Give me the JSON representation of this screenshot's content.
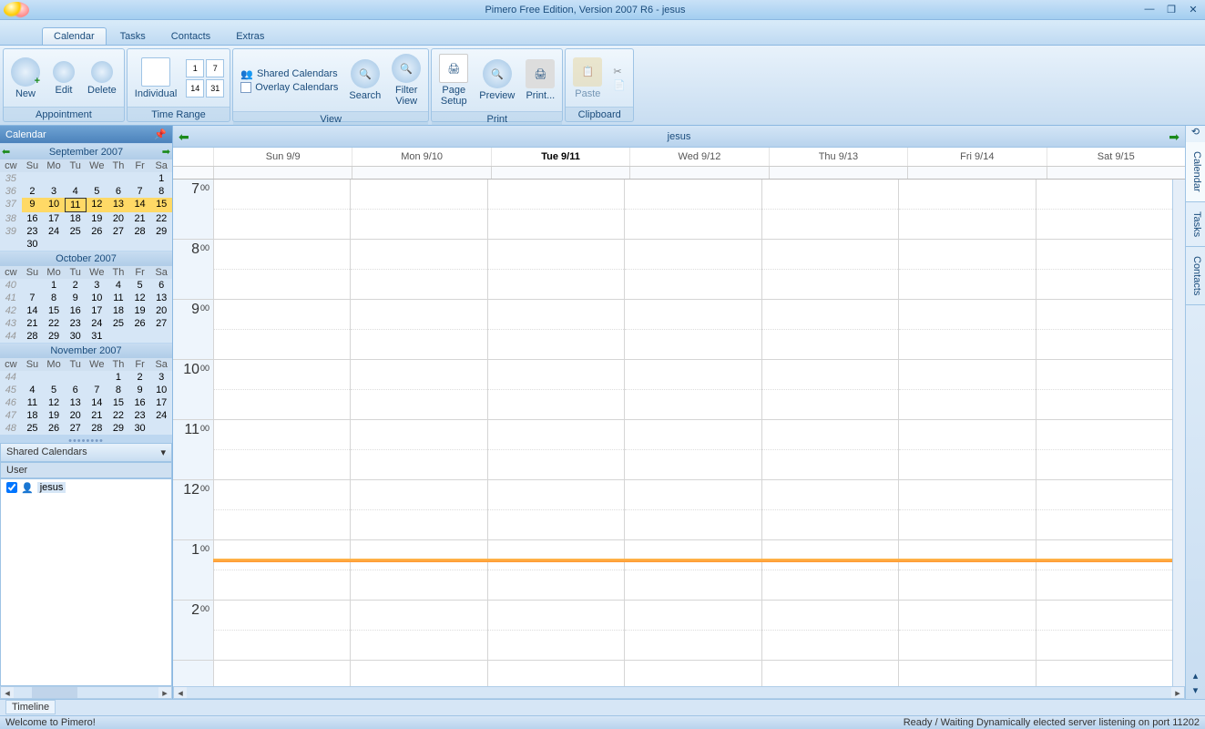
{
  "title": "Pimero Free Edition, Version 2007 R6 - jesus",
  "tabs": {
    "calendar": "Calendar",
    "tasks": "Tasks",
    "contacts": "Contacts",
    "extras": "Extras"
  },
  "ribbon": {
    "appointment": {
      "label": "Appointment",
      "new": "New",
      "edit": "Edit",
      "delete": "Delete"
    },
    "timerange": {
      "label": "Time Range",
      "individual": "Individual"
    },
    "view": {
      "label": "View",
      "shared": "Shared Calendars",
      "overlay": "Overlay Calendars",
      "search": "Search",
      "filter": "Filter\nView"
    },
    "print": {
      "label": "Print",
      "pagesetup": "Page\nSetup",
      "preview": "Preview",
      "print": "Print..."
    },
    "clipboard": {
      "label": "Clipboard",
      "paste": "Paste"
    }
  },
  "sidebar": {
    "title": "Calendar",
    "months": [
      {
        "name": "September 2007",
        "dh": [
          "cw",
          "Su",
          "Mo",
          "Tu",
          "We",
          "Th",
          "Fr",
          "Sa"
        ],
        "rows": [
          [
            "35",
            "",
            "",
            "",
            "",
            "",
            "",
            "1"
          ],
          [
            "36",
            "2",
            "3",
            "4",
            "5",
            "6",
            "7",
            "8"
          ],
          [
            "37",
            "9",
            "10",
            "11",
            "12",
            "13",
            "14",
            "15"
          ],
          [
            "38",
            "16",
            "17",
            "18",
            "19",
            "20",
            "21",
            "22"
          ],
          [
            "39",
            "23",
            "24",
            "25",
            "26",
            "27",
            "28",
            "29"
          ],
          [
            "",
            "30",
            "",
            "",
            "",
            "",
            "",
            ""
          ]
        ],
        "hlrow": 2,
        "today": "11",
        "nav": true
      },
      {
        "name": "October 2007",
        "dh": [
          "cw",
          "Su",
          "Mo",
          "Tu",
          "We",
          "Th",
          "Fr",
          "Sa"
        ],
        "rows": [
          [
            "40",
            "",
            "1",
            "2",
            "3",
            "4",
            "5",
            "6"
          ],
          [
            "41",
            "7",
            "8",
            "9",
            "10",
            "11",
            "12",
            "13"
          ],
          [
            "42",
            "14",
            "15",
            "16",
            "17",
            "18",
            "19",
            "20"
          ],
          [
            "43",
            "21",
            "22",
            "23",
            "24",
            "25",
            "26",
            "27"
          ],
          [
            "44",
            "28",
            "29",
            "30",
            "31",
            "",
            "",
            ""
          ]
        ]
      },
      {
        "name": "November 2007",
        "dh": [
          "cw",
          "Su",
          "Mo",
          "Tu",
          "We",
          "Th",
          "Fr",
          "Sa"
        ],
        "rows": [
          [
            "44",
            "",
            "",
            "",
            "",
            "1",
            "2",
            "3"
          ],
          [
            "45",
            "4",
            "5",
            "6",
            "7",
            "8",
            "9",
            "10"
          ],
          [
            "46",
            "11",
            "12",
            "13",
            "14",
            "15",
            "16",
            "17"
          ],
          [
            "47",
            "18",
            "19",
            "20",
            "21",
            "22",
            "23",
            "24"
          ],
          [
            "48",
            "25",
            "26",
            "27",
            "28",
            "29",
            "30",
            ""
          ]
        ]
      }
    ],
    "shared": {
      "title": "Shared Calendars",
      "userhdr": "User",
      "user": "jesus"
    }
  },
  "calview": {
    "user": "jesus",
    "days": [
      "Sun 9/9",
      "Mon 9/10",
      "Tue 9/11",
      "Wed 9/12",
      "Thu 9/13",
      "Fri 9/14",
      "Sat 9/15"
    ],
    "today_idx": 2,
    "hours": [
      [
        "7",
        "00"
      ],
      [
        "8",
        "00"
      ],
      [
        "9",
        "00"
      ],
      [
        "10",
        "00"
      ],
      [
        "11",
        "00"
      ],
      [
        "12",
        "00"
      ],
      [
        "1",
        "00"
      ],
      [
        "2",
        "00"
      ]
    ]
  },
  "vtabs": {
    "calendar": "Calendar",
    "tasks": "Tasks",
    "contacts": "Contacts"
  },
  "timeline": "Timeline",
  "status": {
    "left": "Welcome to Pimero!",
    "right": "Ready / Waiting  Dynamically elected server listening on port 11202"
  }
}
